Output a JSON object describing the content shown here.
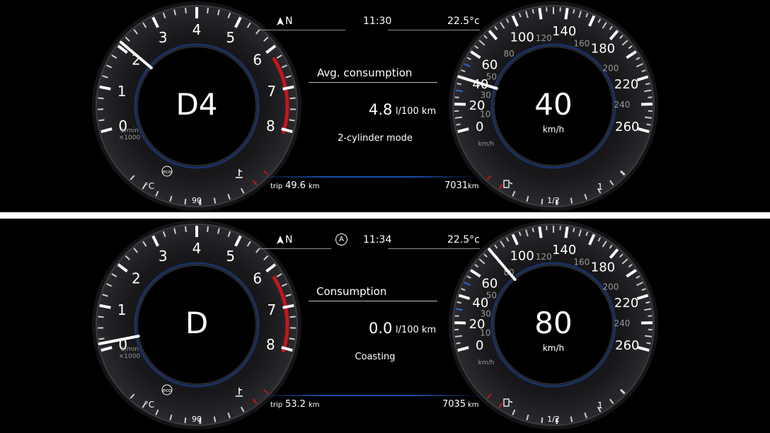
{
  "top": {
    "compass": "N",
    "time": "11:30",
    "temperature": "22.5°c",
    "gear": "D4",
    "info_title": "Avg. consumption",
    "consumption_value": "4.8",
    "consumption_unit": "l/100 km",
    "mode_text": "2-cylinder mode",
    "speed": "40",
    "speed_unit": "km/h",
    "trip_label": "trip",
    "trip_value": "49.6",
    "trip_unit": "km",
    "odometer_value": "7031",
    "odometer_unit": "km",
    "rpm_needle_value": 2.1,
    "speed_needle_value": 40
  },
  "bottom": {
    "compass": "N",
    "auto_indicator": "A",
    "time": "11:34",
    "temperature": "22.5°c",
    "gear": "D",
    "info_title": "Consumption",
    "consumption_value": "0.0",
    "consumption_unit": "l/100 km",
    "mode_text": "Coasting",
    "speed": "80",
    "speed_unit": "km/h",
    "trip_label": "trip",
    "trip_value": "53.2",
    "trip_unit": "km",
    "odometer_value": "7035",
    "odometer_unit": "km",
    "rpm_needle_value": 0.15,
    "speed_needle_value": 80
  },
  "tacho": {
    "labels": [
      "0",
      "1",
      "2",
      "3",
      "4",
      "5",
      "6",
      "7",
      "8"
    ],
    "unit_line1": "1/min",
    "unit_line2": "×1000",
    "eco_label": "eco",
    "coolant_unit": "°C",
    "coolant_mid": "90"
  },
  "speedo": {
    "major_labels": [
      "0",
      "20",
      "40",
      "60",
      "100",
      "140",
      "180",
      "220",
      "260"
    ],
    "minor_labels": [
      "10",
      "30",
      "50",
      "80",
      "120",
      "160",
      "200",
      "240"
    ],
    "unit_small": "km/h",
    "fuel_half": "1/2",
    "fuel_full": "1"
  },
  "colors": {
    "background": "#000000",
    "redline": "#c4161c",
    "accent_blue": "#1c4ea8",
    "needle": "#ffffff"
  }
}
